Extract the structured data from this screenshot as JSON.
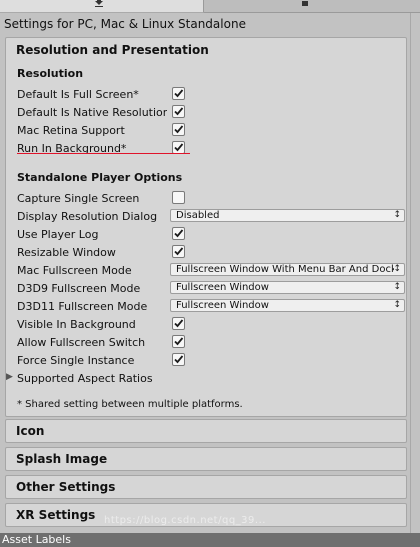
{
  "header": {
    "title": "Settings for PC, Mac & Linux Standalone"
  },
  "tabs": {
    "selected_icon": "download-icon",
    "other_icon": "android-icon"
  },
  "resolution_panel": {
    "title": "Resolution and Presentation",
    "resolution_section": {
      "title": "Resolution",
      "rows": [
        {
          "label": "Default Is Full Screen*",
          "checked": true
        },
        {
          "label": "Default Is Native Resolution",
          "checked": true
        },
        {
          "label": "Mac Retina Support",
          "checked": true
        },
        {
          "label": "Run In Background*",
          "checked": true
        }
      ]
    },
    "standalone_section": {
      "title": "Standalone Player Options",
      "capture_single_screen": {
        "label": "Capture Single Screen",
        "checked": false
      },
      "display_resolution_dialog": {
        "label": "Display Resolution Dialog",
        "value": "Disabled"
      },
      "use_player_log": {
        "label": "Use Player Log",
        "checked": true
      },
      "resizable_window": {
        "label": "Resizable Window",
        "checked": true
      },
      "mac_fullscreen_mode": {
        "label": "Mac Fullscreen Mode",
        "value": "Fullscreen Window With Menu Bar And Dock"
      },
      "d3d9_fullscreen_mode": {
        "label": "D3D9 Fullscreen Mode",
        "value": "Fullscreen Window"
      },
      "d3d11_fullscreen_mode": {
        "label": "D3D11 Fullscreen Mode",
        "value": "Fullscreen Window"
      },
      "visible_in_background": {
        "label": "Visible In Background",
        "checked": true
      },
      "allow_fullscreen_switch": {
        "label": "Allow Fullscreen Switch",
        "checked": true
      },
      "force_single_instance": {
        "label": "Force Single Instance",
        "checked": true
      },
      "supported_aspect_ratios": {
        "label": "Supported Aspect Ratios"
      }
    },
    "shared_note": "* Shared setting between multiple platforms."
  },
  "sections": {
    "icon": "Icon",
    "splash_image": "Splash Image",
    "other_settings": "Other Settings",
    "xr_settings": "XR Settings"
  },
  "watermark": "https://blog.csdn.net/qq_39...",
  "bottom_bar": {
    "label": "Asset Labels"
  },
  "colors": {
    "underline": "#e0132a",
    "panel": "#d6d6d6",
    "bottom_bar": "#6f6f6f"
  }
}
